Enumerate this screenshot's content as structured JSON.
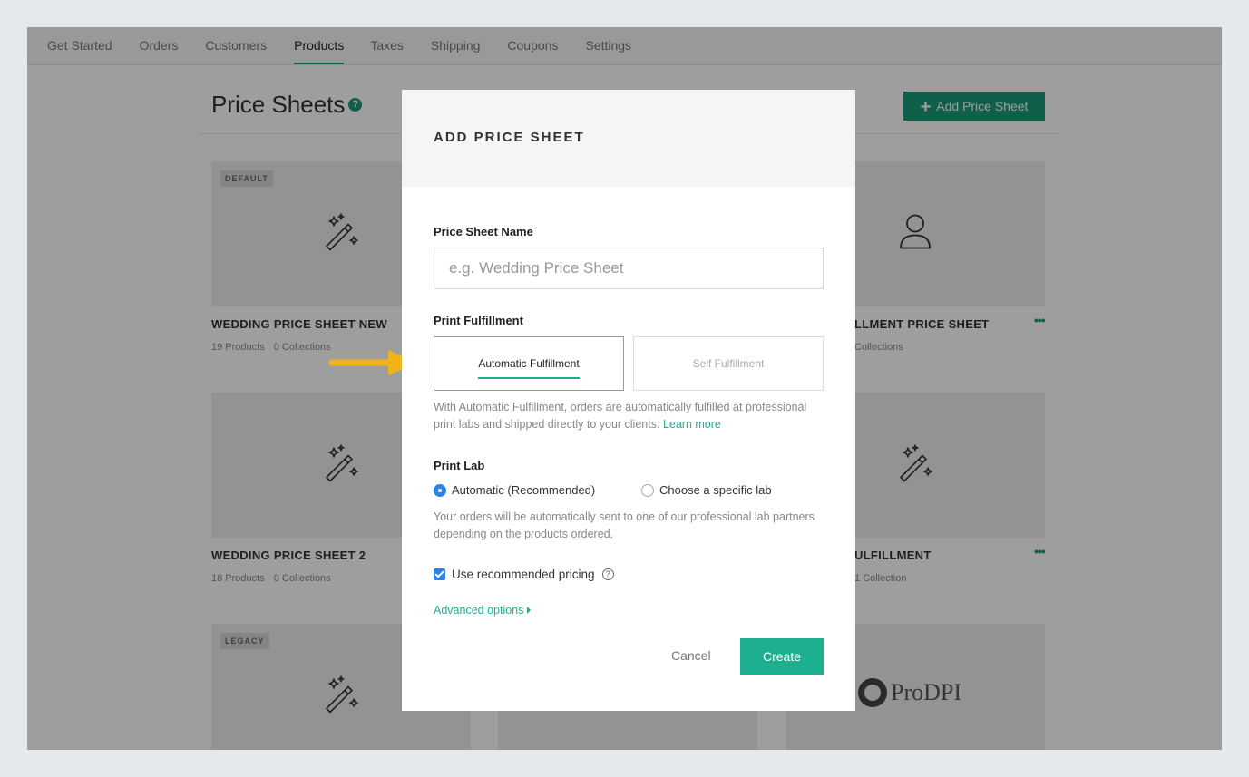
{
  "nav": {
    "tabs": [
      "Get Started",
      "Orders",
      "Customers",
      "Products",
      "Taxes",
      "Shipping",
      "Coupons",
      "Settings"
    ],
    "active": "Products"
  },
  "page": {
    "title": "Price Sheets",
    "help_icon": "question-circle-icon",
    "add_button": "Add Price Sheet"
  },
  "cards": [
    {
      "badge": "DEFAULT",
      "icon": "magic-wand-icon",
      "title": "WEDDING PRICE SHEET NEW",
      "products": "19 Products",
      "collections": "0 Collections"
    },
    {
      "badge": "",
      "icon": "person-icon",
      "title": "LLMENT PRICE SHEET",
      "products": "",
      "collections": "Collections"
    },
    {
      "badge": "",
      "icon": "magic-wand-icon",
      "title": "WEDDING PRICE SHEET 2",
      "products": "18 Products",
      "collections": "0 Collections"
    },
    {
      "badge": "",
      "icon": "magic-wand-icon",
      "title": "ULFILLMENT",
      "products": "",
      "collections": "1 Collection"
    },
    {
      "badge": "LEGACY",
      "icon": "magic-wand-icon",
      "title": "",
      "products": "",
      "collections": ""
    },
    {
      "badge": "",
      "icon": "prodpi-logo",
      "brand": "ProDPI"
    }
  ],
  "modal": {
    "title": "ADD PRICE SHEET",
    "name_label": "Price Sheet Name",
    "name_placeholder": "e.g. Wedding Price Sheet",
    "name_value": "",
    "fulfillment_label": "Print Fulfillment",
    "fulfillment_options": [
      "Automatic Fulfillment",
      "Self Fulfillment"
    ],
    "fulfillment_selected": "Automatic Fulfillment",
    "fulfillment_desc": "With Automatic Fulfillment, orders are automatically fulfilled at professional print labs and shipped directly to your clients.",
    "learn_more": "Learn more",
    "print_lab_label": "Print Lab",
    "lab_options": [
      "Automatic (Recommended)",
      "Choose a specific lab"
    ],
    "lab_selected": "Automatic (Recommended)",
    "lab_desc": "Your orders will be automatically sent to one of our professional lab partners depending on the products ordered.",
    "pricing_checkbox": "Use recommended pricing",
    "pricing_checked": true,
    "advanced": "Advanced options",
    "cancel": "Cancel",
    "create": "Create"
  },
  "colors": {
    "accent": "#1db08f",
    "dark_accent": "#1a9a78",
    "radio_blue": "#2a83e8",
    "arrow": "#f2b318"
  }
}
